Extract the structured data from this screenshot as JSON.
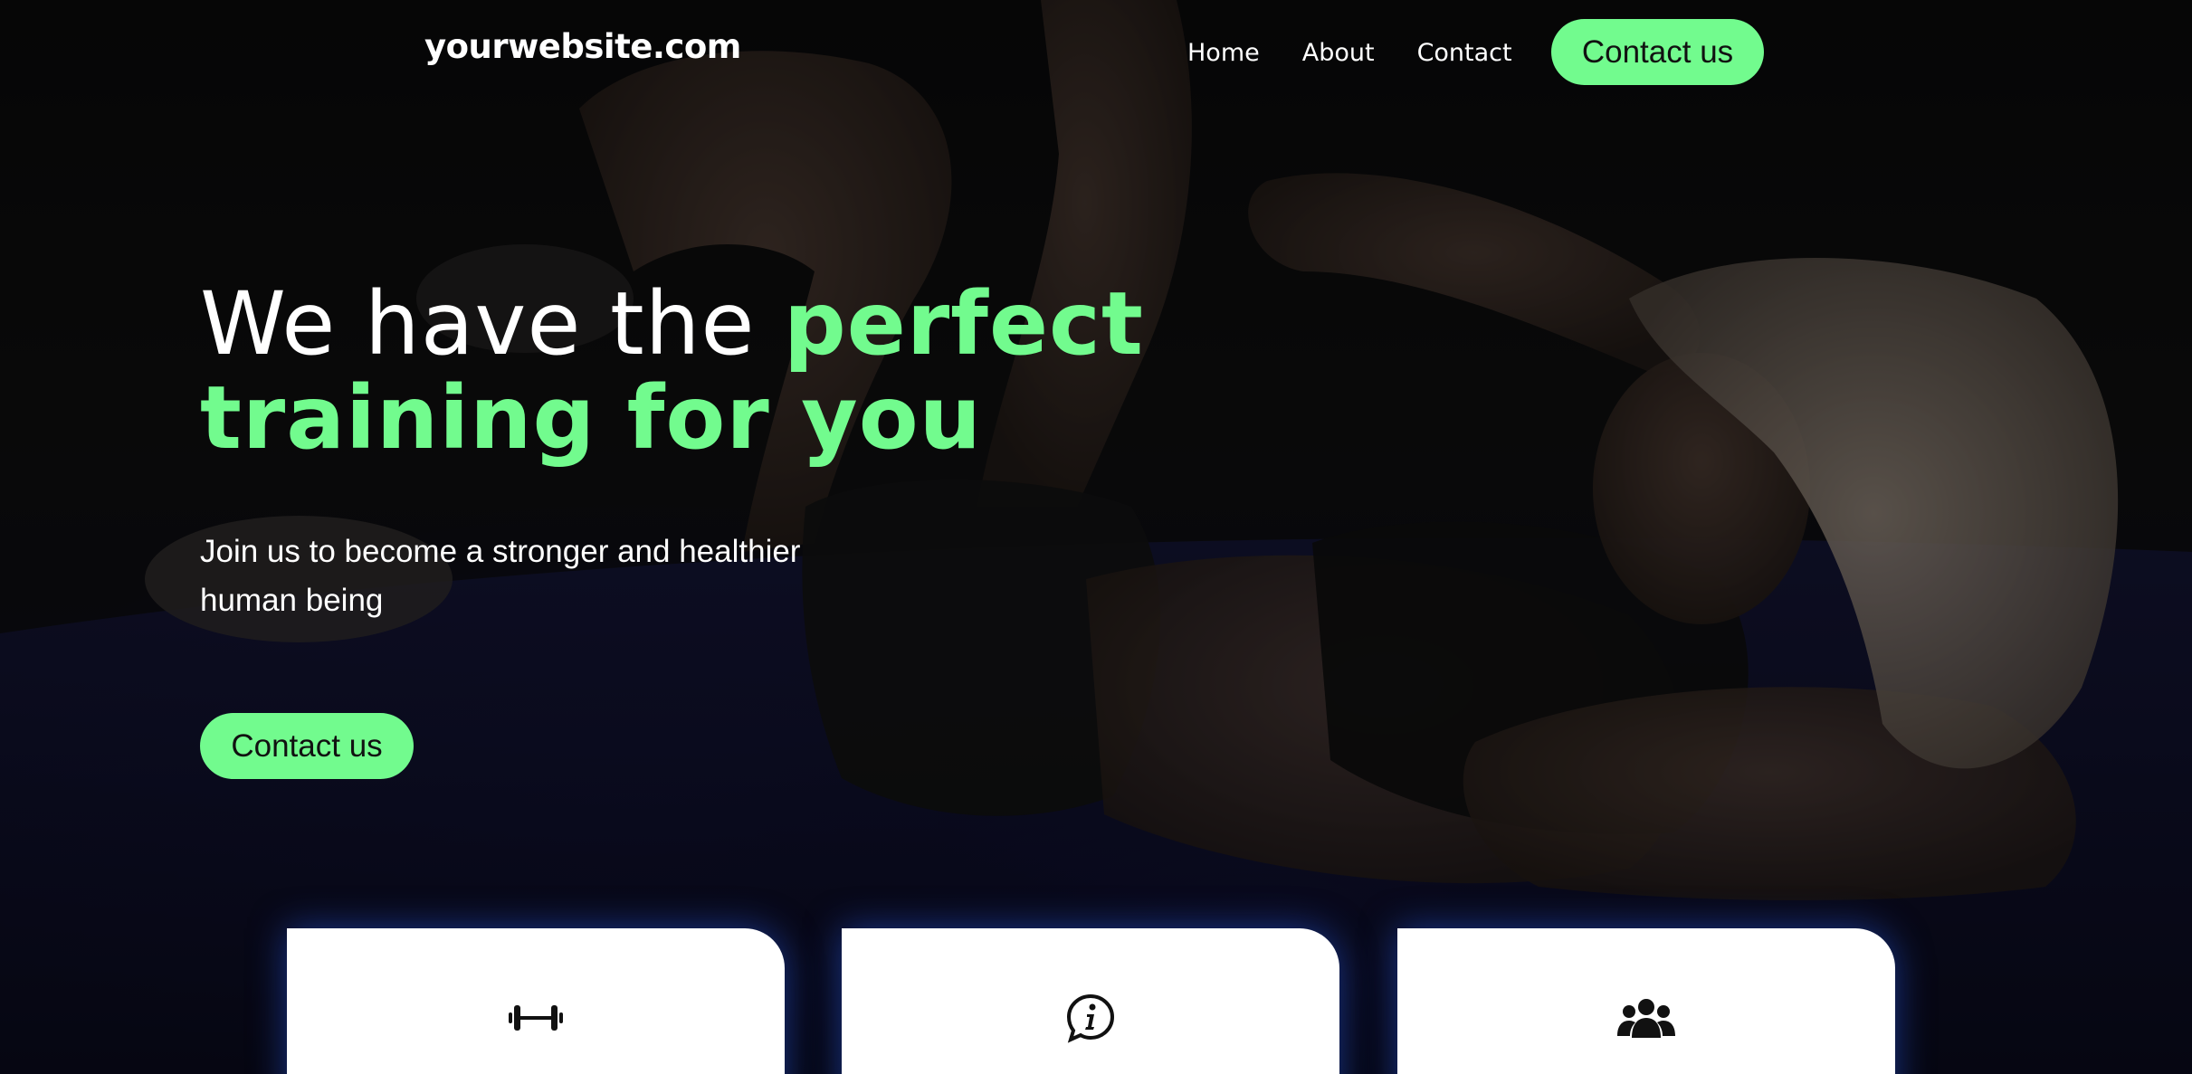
{
  "site": {
    "logo": "yourwebsite.com"
  },
  "nav": {
    "items": [
      "Home",
      "About",
      "Contact"
    ],
    "cta_label": "Contact us"
  },
  "hero": {
    "headline_white": "We have the ",
    "headline_green_1": "perfect",
    "headline_green_2": "training for you",
    "subtext": "Join us to become a stronger and healthier human being",
    "cta_label": "Contact us"
  },
  "cards": [
    {
      "icon": "dumbbell-icon"
    },
    {
      "icon": "info-chat-icon"
    },
    {
      "icon": "users-group-icon"
    }
  ],
  "colors": {
    "accent": "#72fb8e",
    "background": "#0a0a0c",
    "text": "#ffffff",
    "card": "#ffffff",
    "card_glow": "#285ae6"
  }
}
